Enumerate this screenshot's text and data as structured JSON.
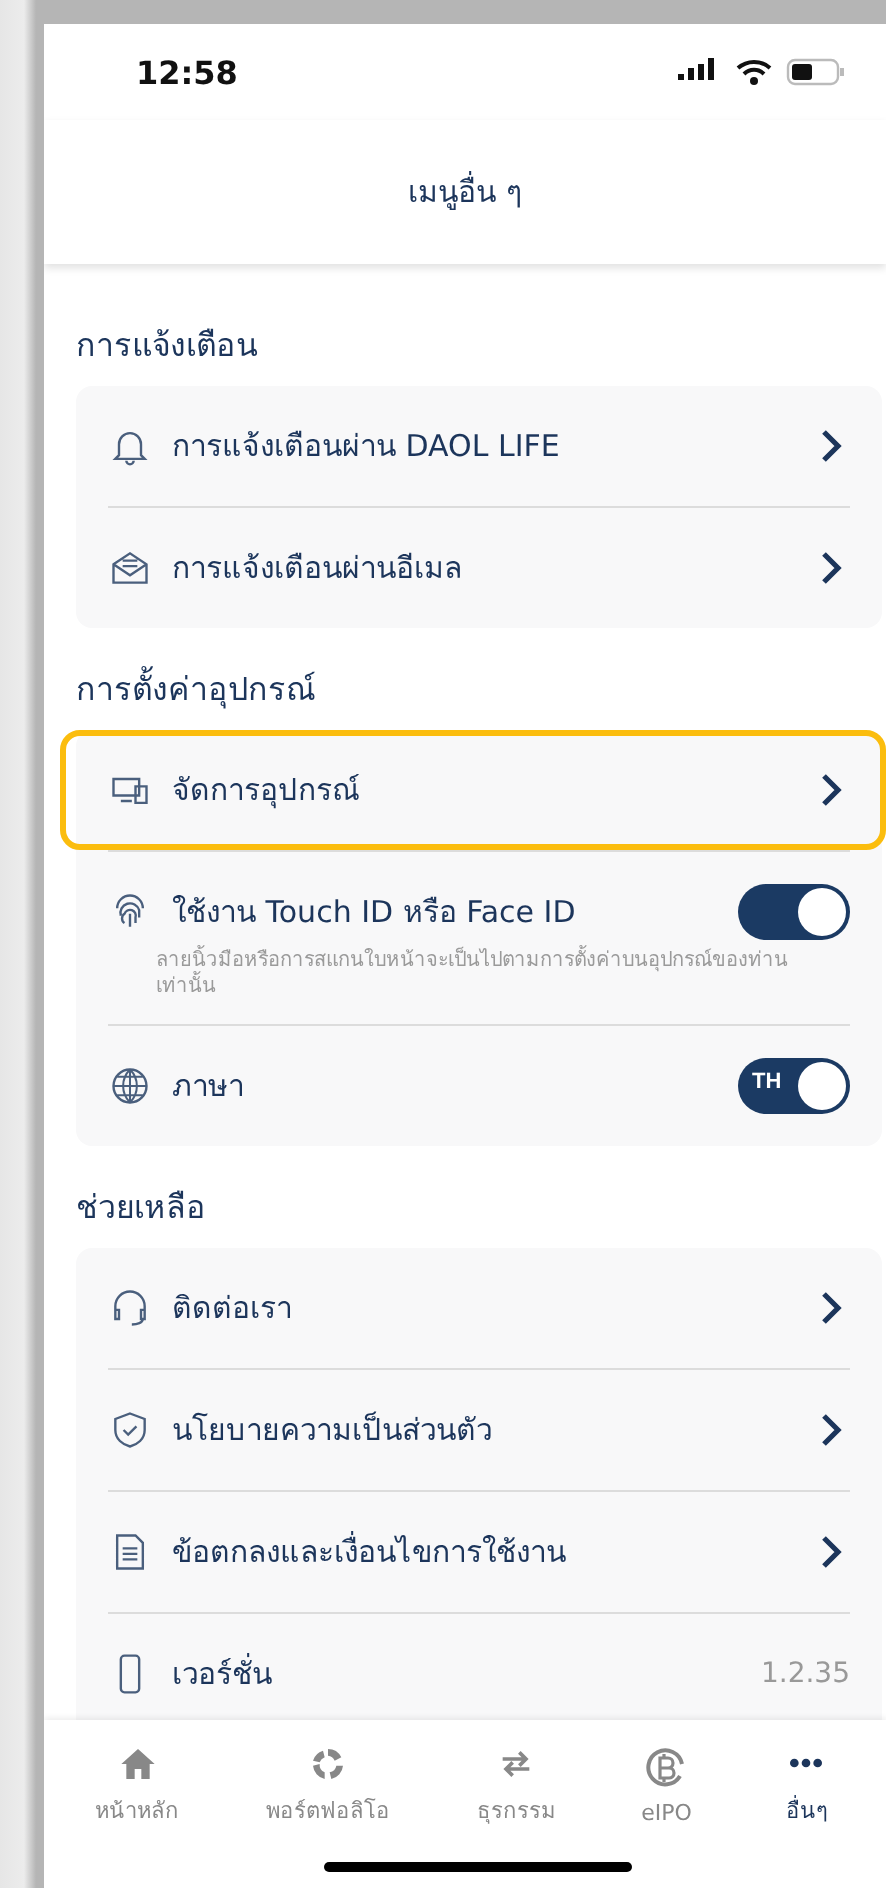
{
  "status_bar": {
    "time": "12:58"
  },
  "header": {
    "title": "เมนูอื่น ๆ"
  },
  "sections": [
    {
      "title": "การแจ้งเตือน",
      "rows": [
        {
          "kind": "link",
          "label": "การแจ้งเตือนผ่าน DAOL LIFE",
          "highlighted": false
        },
        {
          "kind": "link",
          "label": "การแจ้งเตือนผ่านอีเมล",
          "highlighted": false
        }
      ]
    },
    {
      "title": "การตั้งค่าอุปกรณ์",
      "rows": [
        {
          "kind": "link",
          "label": "จัดการอุปกรณ์",
          "highlighted": true
        },
        {
          "kind": "toggle",
          "label": "ใช้งาน Touch ID หรือ Face ID",
          "on": true,
          "note": "ลายนิ้วมือหรือการสแกนใบหน้าจะเป็นไปตามการตั้งค่าบนอุปกรณ์ของท่านเท่านั้น",
          "highlighted": false
        },
        {
          "kind": "toggle",
          "label": "ภาษา",
          "on": true,
          "badge": "TH",
          "highlighted": false
        }
      ]
    },
    {
      "title": "ช่วยเหลือ",
      "rows": [
        {
          "kind": "link",
          "label": "ติดต่อเรา",
          "highlighted": false
        },
        {
          "kind": "link",
          "label": "นโยบายความเป็นส่วนตัว",
          "highlighted": false
        },
        {
          "kind": "link",
          "label": "ข้อตกลงและเงื่อนไขการใช้งาน",
          "highlighted": false
        },
        {
          "kind": "value",
          "label": "เวอร์ชั่น",
          "value": "1.2.35",
          "highlighted": false
        }
      ]
    }
  ],
  "tab_bar": [
    {
      "label": "หน้าหลัก",
      "selected": false
    },
    {
      "label": "พอร์ตฟอลิโอ",
      "selected": false
    },
    {
      "label": "ธุรกรรม",
      "selected": false
    },
    {
      "label": "eIPO",
      "selected": false
    },
    {
      "label": "อื่นๆ",
      "selected": true
    }
  ]
}
